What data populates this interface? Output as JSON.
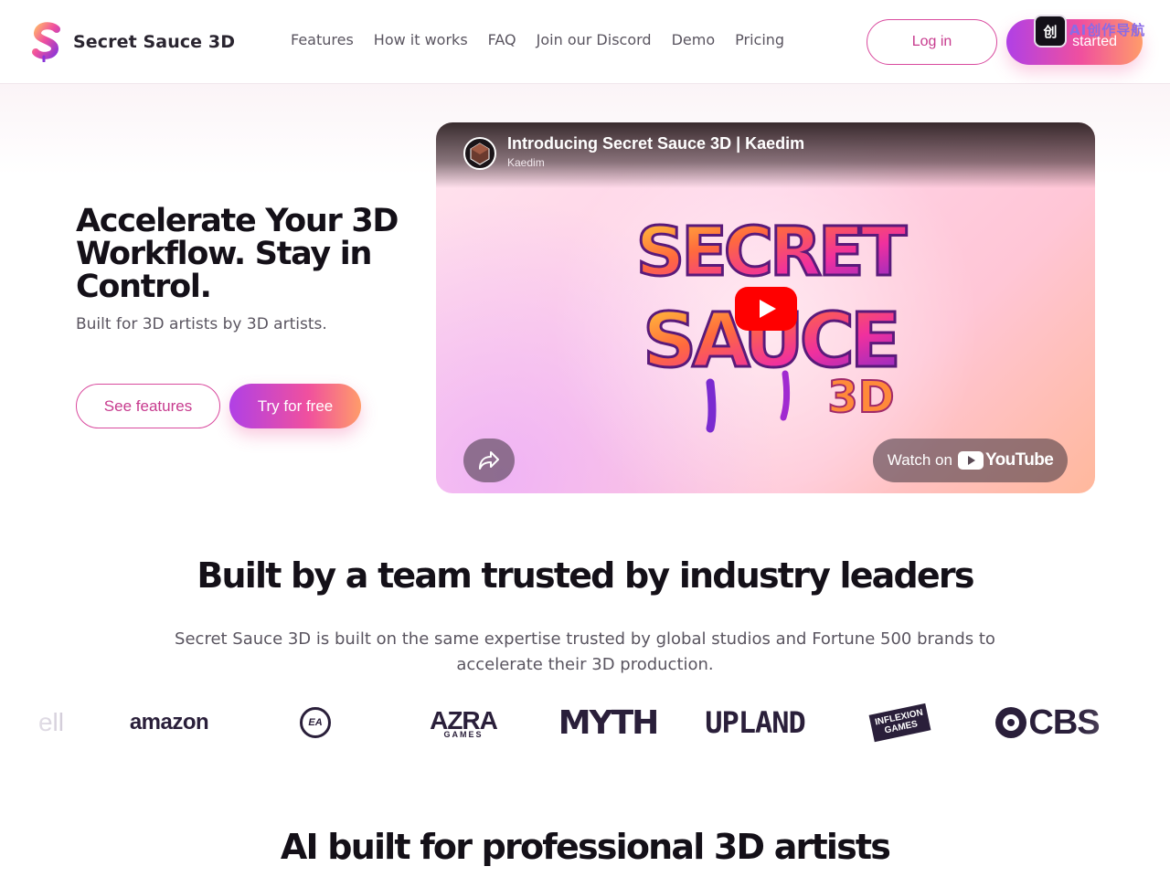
{
  "brand": {
    "name": "Secret Sauce 3D",
    "logo_icon": "secret-sauce-s-logo"
  },
  "nav": {
    "links": [
      "Features",
      "How it works",
      "FAQ",
      "Join our Discord",
      "Demo",
      "Pricing"
    ],
    "login_label": "Log in",
    "cta_label": "started"
  },
  "overlay": {
    "badge_label": "创",
    "text": "AI创作导航"
  },
  "hero": {
    "title": "Accelerate Your 3D Workflow. Stay in Control.",
    "subtitle": "Built for 3D artists by 3D artists.",
    "secondary_button": "See features",
    "primary_button": "Try for free"
  },
  "video": {
    "title": "Introducing Secret Sauce 3D | Kaedim",
    "channel": "Kaedim",
    "artwork_text": [
      "SECRET",
      "SAUCE",
      "3D"
    ],
    "watch_label": "Watch on",
    "platform": "YouTube",
    "icons": [
      "play-icon",
      "share-icon",
      "youtube-icon"
    ]
  },
  "trust": {
    "title": "Built by a team trusted by industry leaders",
    "description": "Secret Sauce 3D is built on the same expertise trusted by global studios and Fortune 500 brands to accelerate their 3D production.",
    "logos": {
      "dell": "ell",
      "amazon": "amazon",
      "ea": "EA",
      "azra": "AZRA",
      "azra_sub": "GAMES",
      "myth": "MYTH",
      "upland": "UPLAND",
      "inflexion": "INFLEXION",
      "inflexion_sub": "GAMES",
      "cbs": "CBS"
    }
  },
  "next_section": {
    "title": "AI built for professional 3D artists"
  },
  "colors": {
    "accent_pink": "#d94a9e",
    "gradient_start": "#b040e6",
    "gradient_mid": "#f0509e",
    "gradient_end": "#ff9c6a",
    "heading": "#141018",
    "body_text": "#5a5560"
  }
}
